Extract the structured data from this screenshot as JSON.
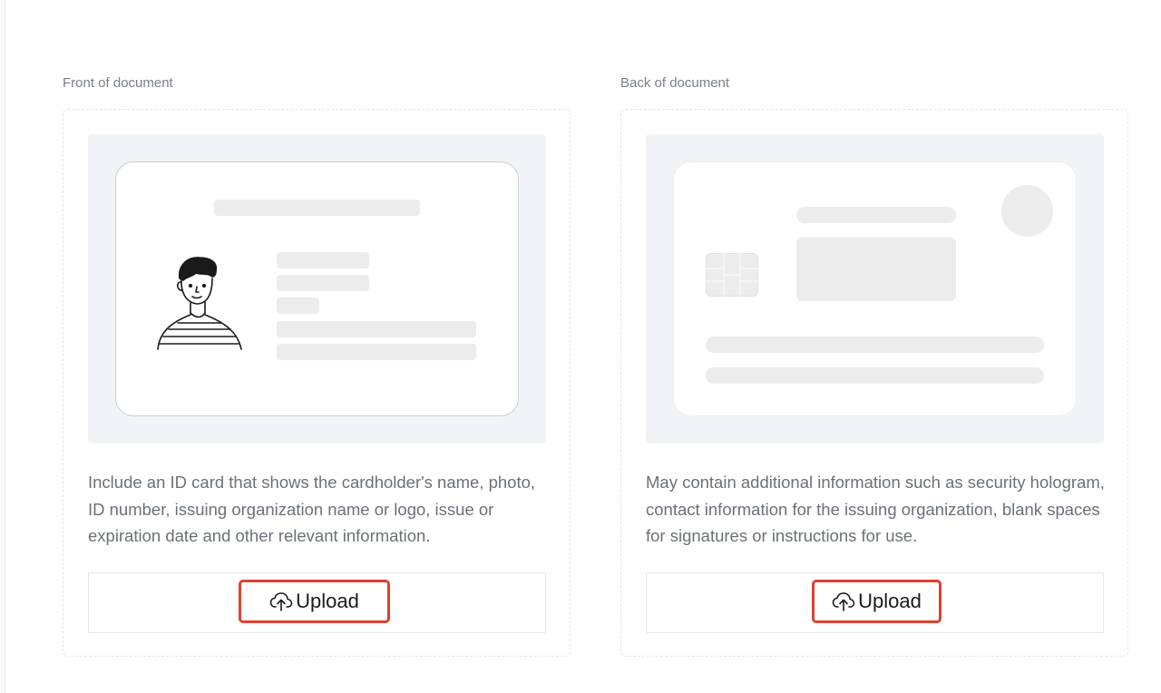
{
  "front": {
    "label": "Front of document",
    "description": "Include an ID card that shows the cardholder's name, photo, ID number, issuing organization name or logo, issue or expiration date and other relevant information.",
    "upload_label": "Upload"
  },
  "back": {
    "label": "Back of document",
    "description": "May contain additional information such as security hologram, contact information for the issuing organization, blank spaces for signatures or instructions for use.",
    "upload_label": "Upload"
  },
  "colors": {
    "accent_highlight": "#e0402f",
    "muted_text": "#6b7178",
    "preview_bg": "#f1f3f6"
  },
  "icons": {
    "upload": "cloud-upload-icon"
  }
}
